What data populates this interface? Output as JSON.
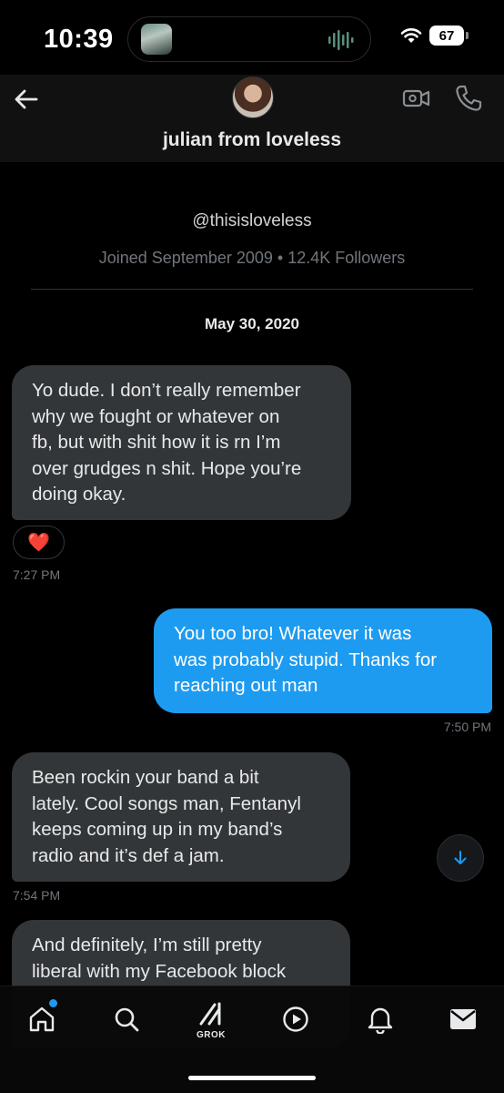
{
  "status_bar": {
    "time": "10:39",
    "battery": "67"
  },
  "header": {
    "name": "julian from loveless"
  },
  "profile": {
    "handle": "@thisisloveless",
    "joined": "Joined September 2009 • 12.4K Followers"
  },
  "date_separator": "May 30, 2020",
  "messages": [
    {
      "direction": "incoming",
      "lines": [
        "Yo dude. I don’t really remember",
        "why we fought or whatever on",
        "fb, but with shit how it is rn I’m",
        "over grudges n shit. Hope you’re",
        "doing okay."
      ],
      "time": "7:27 PM",
      "reaction": "❤️"
    },
    {
      "direction": "outgoing",
      "lines": [
        "You too bro! Whatever it was",
        "was probably stupid. Thanks for",
        "reaching out man"
      ],
      "time": "7:50 PM"
    },
    {
      "direction": "incoming",
      "lines": [
        "Been rockin your band a bit",
        "lately. Cool songs man, Fentanyl",
        "keeps coming up in my band’s",
        "radio and it’s def a jam."
      ],
      "time": "7:54 PM"
    },
    {
      "direction": "incoming",
      "lines": [
        "And definitely, I’m still pretty",
        "liberal with my Facebook block"
      ]
    }
  ],
  "nav": {
    "grok_label": "GROK"
  },
  "colors": {
    "accent": "#1d9bf0",
    "incoming_bubble": "#333639",
    "muted_text": "#71767b"
  }
}
